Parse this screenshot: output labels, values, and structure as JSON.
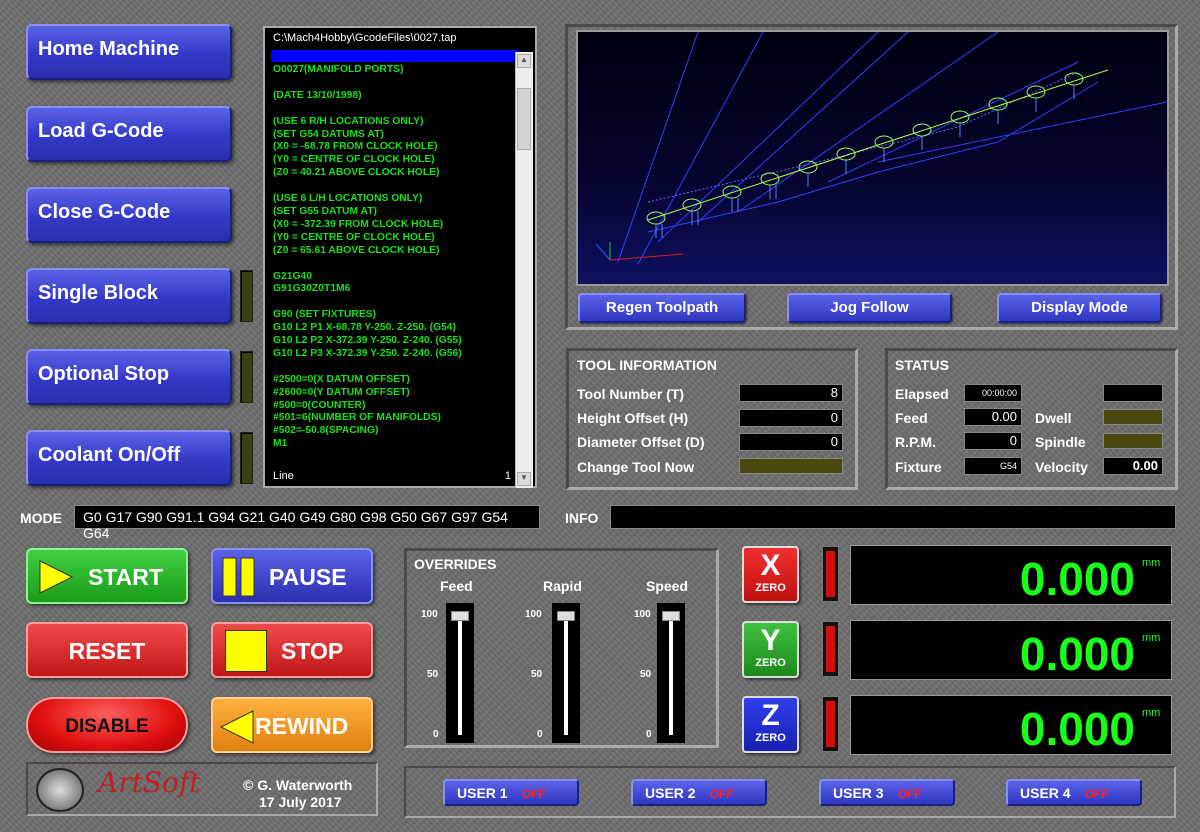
{
  "left_buttons": [
    "Home Machine",
    "Load G-Code",
    "Close G-Code",
    "Single Block",
    "Optional Stop",
    "Coolant On/Off"
  ],
  "gcode": {
    "path": "C:\\Mach4Hobby\\GcodeFiles\\0027.tap",
    "lines": "O0027(MANIFOLD PORTS)\n\n(DATE 13/10/1998)\n\n(USE 6 R/H LOCATIONS ONLY)\n(SET G54 DATUMS AT)\n(X0 = -68.78 FROM CLOCK HOLE)\n(Y0 = CENTRE OF CLOCK HOLE)\n(Z0 = 40.21 ABOVE CLOCK HOLE)\n\n(USE 6 L/H LOCATIONS ONLY)\n(SET G55 DATUM AT)\n(X0 = -372.39 FROM CLOCK HOLE)\n(Y0 = CENTRE OF CLOCK HOLE)\n(Z0 = 65.61 ABOVE CLOCK HOLE)\n\nG21G40\nG91G30Z0T1M6\n\nG90 (SET FIXTURES)\nG10 L2 P1 X-68.78 Y-250. Z-250. (G54)\nG10 L2 P2 X-372.39 Y-250. Z-240. (G55)\nG10 L2 P3 X-372.39 Y-250. Z-240. (G56)\n\n#2500=0(X DATUM OFFSET)\n#2600=0(Y DATUM OFFSET)\n#500=0(COUNTER)\n#501=6(NUMBER OF MANIFOLDS)\n#502=-50.8(SPACING)\nM1",
    "line_label": "Line",
    "line_value": "1"
  },
  "view_buttons": [
    "Regen Toolpath",
    "Jog Follow",
    "Display Mode"
  ],
  "tool_info": {
    "title": "TOOL INFORMATION",
    "rows": [
      {
        "label": "Tool Number (T)",
        "value": "8"
      },
      {
        "label": "Height Offset (H)",
        "value": "0"
      },
      {
        "label": "Diameter Offset (D)",
        "value": "0"
      },
      {
        "label": "Change Tool Now",
        "value": ""
      }
    ]
  },
  "status": {
    "title": "STATUS",
    "elapsed_label": "Elapsed",
    "elapsed": "00:00:00",
    "feed_label": "Feed",
    "feed": "0.00",
    "rpm_label": "R.P.M.",
    "rpm": "0",
    "fixture_label": "Fixture",
    "fixture": "G54",
    "dwell_label": "Dwell",
    "spindle_label": "Spindle",
    "velocity_label": "Velocity",
    "velocity": "0.00"
  },
  "mode": {
    "label": "MODE",
    "value": "G0 G17 G90 G91.1 G94 G21 G40 G49 G80 G98 G50 G67 G97 G54 G64"
  },
  "info": {
    "label": "INFO",
    "value": ""
  },
  "controls": {
    "start": "START",
    "pause": "PAUSE",
    "reset": "RESET",
    "stop": "STOP",
    "disable": "DISABLE",
    "rewind": "REWIND"
  },
  "overrides": {
    "title": "OVERRIDES",
    "sliders": [
      {
        "label": "Feed",
        "value": 100
      },
      {
        "label": "Rapid",
        "value": 100
      },
      {
        "label": "Speed",
        "value": 100
      }
    ],
    "ticks": [
      "100",
      "50",
      "0"
    ]
  },
  "axes": [
    {
      "letter": "X",
      "zero": "ZERO",
      "value": "0.000",
      "unit": "mm",
      "color": "#e02020"
    },
    {
      "letter": "Y",
      "zero": "ZERO",
      "value": "0.000",
      "unit": "mm",
      "color": "#30b030"
    },
    {
      "letter": "Z",
      "zero": "ZERO",
      "value": "0.000",
      "unit": "mm",
      "color": "#2030e0"
    }
  ],
  "logo": {
    "brand": "ArtSoft",
    "credit": "© G. Waterworth",
    "date": "17 July 2017"
  },
  "user_buttons": [
    {
      "label": "USER 1",
      "state": "OFF"
    },
    {
      "label": "USER 2",
      "state": "OFF"
    },
    {
      "label": "USER 3",
      "state": "OFF"
    },
    {
      "label": "USER 4",
      "state": "OFF"
    }
  ],
  "colors": {
    "accent_blue": "#3339c6",
    "dro_green": "#19ff19",
    "led_red": "#d01010"
  }
}
